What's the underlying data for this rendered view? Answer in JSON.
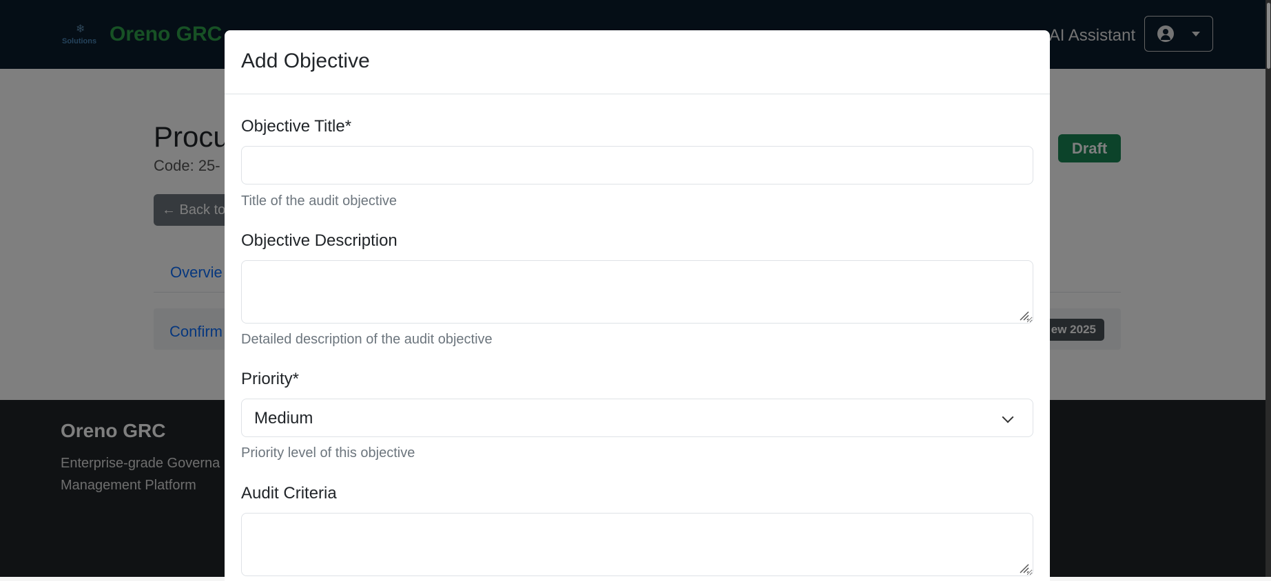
{
  "navbar": {
    "logo_text": "Solutions",
    "brand": "Oreno GRC",
    "ai_assistant": "AI Assistant"
  },
  "page": {
    "title": "Procu",
    "code": "Code: 25-",
    "status": "Draft",
    "back_button": "← Back to",
    "tab_overview": "Overvie",
    "confirm_link": "Confirm",
    "review_badge": "ew 2025"
  },
  "footer": {
    "brand": "Oreno GRC",
    "tagline_line1": "Enterprise-grade Governa",
    "tagline_line2": "Management Platform"
  },
  "modal": {
    "title": "Add Objective",
    "fields": {
      "title_label": "Objective Title*",
      "title_value": "",
      "title_help": "Title of the audit objective",
      "description_label": "Objective Description",
      "description_value": "",
      "description_help": "Detailed description of the audit objective",
      "priority_label": "Priority*",
      "priority_value": "Medium",
      "priority_help": "Priority level of this objective",
      "criteria_label": "Audit Criteria",
      "criteria_value": ""
    }
  },
  "colors": {
    "navbar_bg": "#0b1c2c",
    "brand_green": "#2fa34a",
    "badge_green": "#198754",
    "link_blue": "#0d6efd",
    "footer_bg": "#212529"
  }
}
